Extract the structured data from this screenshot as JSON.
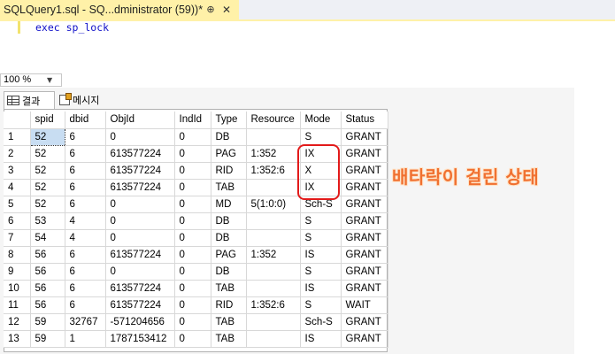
{
  "tab": {
    "title": "SQLQuery1.sql - SQ...dministrator (59))*",
    "pin_glyph": "⊕",
    "close_glyph": "✕"
  },
  "editor": {
    "code": "exec sp_lock"
  },
  "zoom": {
    "value": "100 %",
    "arrow": "▼"
  },
  "results_tabs": {
    "results_label": "결과",
    "messages_label": "메시지"
  },
  "grid": {
    "columns": [
      "",
      "spid",
      "dbid",
      "ObjId",
      "IndId",
      "Type",
      "Resource",
      "Mode",
      "Status"
    ],
    "rows": [
      [
        "1",
        "52",
        "6",
        "0",
        "0",
        "DB",
        "",
        "S",
        "GRANT"
      ],
      [
        "2",
        "52",
        "6",
        "613577224",
        "0",
        "PAG",
        "1:352",
        "IX",
        "GRANT"
      ],
      [
        "3",
        "52",
        "6",
        "613577224",
        "0",
        "RID",
        "1:352:6",
        "X",
        "GRANT"
      ],
      [
        "4",
        "52",
        "6",
        "613577224",
        "0",
        "TAB",
        "",
        "IX",
        "GRANT"
      ],
      [
        "5",
        "52",
        "6",
        "0",
        "0",
        "MD",
        "5(1:0:0)",
        "Sch-S",
        "GRANT"
      ],
      [
        "6",
        "53",
        "4",
        "0",
        "0",
        "DB",
        "",
        "S",
        "GRANT"
      ],
      [
        "7",
        "54",
        "4",
        "0",
        "0",
        "DB",
        "",
        "S",
        "GRANT"
      ],
      [
        "8",
        "56",
        "6",
        "613577224",
        "0",
        "PAG",
        "1:352",
        "IS",
        "GRANT"
      ],
      [
        "9",
        "56",
        "6",
        "0",
        "0",
        "DB",
        "",
        "S",
        "GRANT"
      ],
      [
        "10",
        "56",
        "6",
        "613577224",
        "0",
        "TAB",
        "",
        "IS",
        "GRANT"
      ],
      [
        "11",
        "56",
        "6",
        "613577224",
        "0",
        "RID",
        "1:352:6",
        "S",
        "WAIT"
      ],
      [
        "12",
        "59",
        "32767",
        "-571204656",
        "0",
        "TAB",
        "",
        "Sch-S",
        "GRANT"
      ],
      [
        "13",
        "59",
        "1",
        "1787153412",
        "0",
        "TAB",
        "",
        "IS",
        "GRANT"
      ]
    ]
  },
  "annotation": {
    "text": "배타락이 걸린 상태",
    "color": "#f07030",
    "box_color": "#e21a1a"
  },
  "colors": {
    "tab_active": "#fff1a8",
    "keyword": "#1010c8",
    "selected_cell": "#c8ddf2"
  }
}
